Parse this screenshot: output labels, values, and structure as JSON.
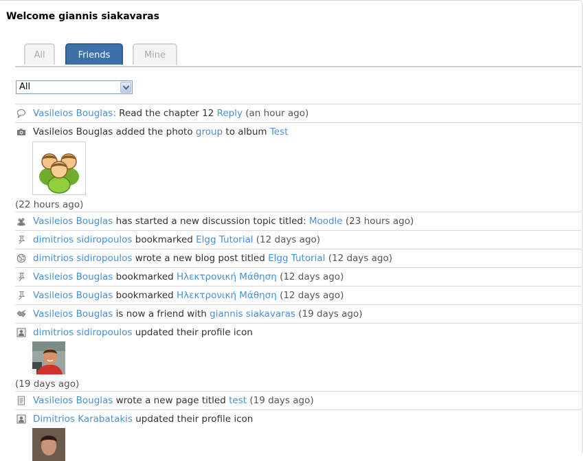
{
  "welcome": "Welcome giannis siakavaras",
  "tabs": [
    "All",
    "Friends",
    "Mine"
  ],
  "filter": {
    "selected": "All"
  },
  "feed": [
    {
      "icon": "speech-bubble-icon",
      "pre": "",
      "actor": "Vasileios Bouglas:",
      "mid": " Read the chapter 12 ",
      "obj": "Reply",
      "post": "",
      "time": " (an hour ago)"
    },
    {
      "icon": "camera-icon",
      "text_a": "Vasileios Bouglas added the photo ",
      "photo": "group",
      "text_b": " to album ",
      "album": "Test",
      "time": "(22 hours ago)"
    },
    {
      "icon": "group-icon",
      "actor": "Vasileios Bouglas",
      "mid": " has started a new discussion topic titled: ",
      "obj": "Moodle",
      "time": " (23 hours ago)"
    },
    {
      "icon": "pushpin-icon",
      "actor": "dimitrios sidiropoulos",
      "mid": " bookmarked ",
      "obj": "Elgg Tutorial",
      "time": " (12 days ago)"
    },
    {
      "icon": "globe-icon",
      "actor": "dimitrios sidiropoulos",
      "mid": " wrote a new blog post titled ",
      "obj": "Elgg Tutorial",
      "time": " (12 days ago)"
    },
    {
      "icon": "pushpin-icon",
      "actor": "Vasileios Bouglas",
      "mid": " bookmarked ",
      "obj": "Ηλεκτρονική Μάθηση",
      "time": " (12 days ago)"
    },
    {
      "icon": "pushpin-icon",
      "actor": "Vasileios Bouglas",
      "mid": " bookmarked ",
      "obj": "Ηλεκτρονική Μάθηση",
      "time": " (12 days ago)"
    },
    {
      "icon": "handshake-icon",
      "actor": "Vasileios Bouglas",
      "mid": " is now a friend with ",
      "obj": "giannis siakavaras",
      "time": " (19 days ago)"
    },
    {
      "icon": "profile-icon",
      "actor": "dimitrios sidiropoulos",
      "mid": " updated their profile icon",
      "time": "(19 days ago)"
    },
    {
      "icon": "page-icon",
      "actor": "Vasileios Bouglas",
      "mid": " wrote a new page titled ",
      "obj": "test",
      "time": " (19 days ago)"
    },
    {
      "icon": "profile-icon",
      "actor": "Dimitrios Karabatakis",
      "mid": " updated their profile icon"
    }
  ]
}
